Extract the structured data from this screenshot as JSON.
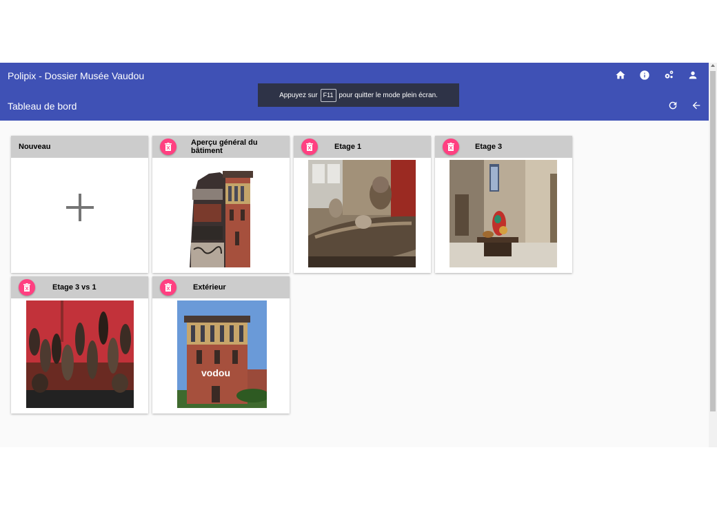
{
  "header": {
    "app_title": "Polipix - Dossier Musée Vaudou",
    "page_title": "Tableau de bord",
    "icons": [
      "home-icon",
      "info-icon",
      "settings-icon",
      "account-icon",
      "refresh-icon",
      "arrow-back-icon"
    ]
  },
  "toast": {
    "before": "Appuyez sur",
    "key": "F11",
    "after": "pour quitter le mode plein écran."
  },
  "cards": {
    "new": {
      "title": "Nouveau"
    },
    "items": [
      {
        "title": "Aperçu général du bâtiment"
      },
      {
        "title": "Etage 1"
      },
      {
        "title": "Etage 3"
      },
      {
        "title": "Etage 3 vs 1"
      },
      {
        "title": "Extérieur",
        "image_text": "vodou"
      }
    ]
  },
  "colors": {
    "appbar": "#3f51b5",
    "toast": "#2e3347",
    "delete_button": "#ff4081",
    "card_header": "#cccccc"
  }
}
